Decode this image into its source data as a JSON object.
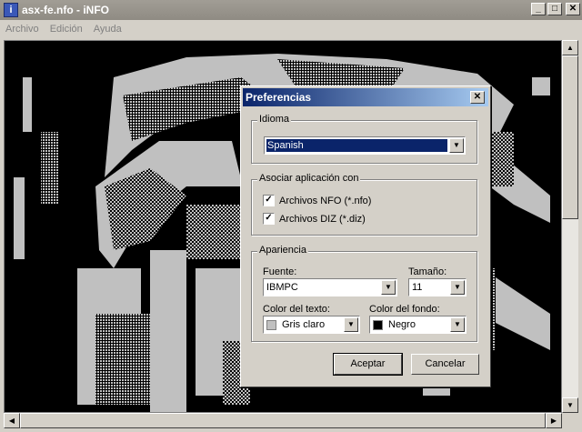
{
  "window": {
    "title": "asx-fe.nfo - iNFO",
    "app_icon": "info-icon"
  },
  "menu": [
    "Archivo",
    "Edición",
    "Ayuda"
  ],
  "dialog": {
    "title": "Preferencias",
    "idioma": {
      "group_label": "Idioma",
      "value": "Spanish"
    },
    "asociar": {
      "group_label": "Asociar aplicación con",
      "options": [
        {
          "label": "Archivos NFO (*.nfo)",
          "checked": true
        },
        {
          "label": "Archivos DIZ (*.diz)",
          "checked": true
        }
      ]
    },
    "apariencia": {
      "group_label": "Apariencia",
      "fuente_label": "Fuente:",
      "fuente_value": "IBMPC",
      "tamano_label": "Tamaño:",
      "tamano_value": "11",
      "color_texto_label": "Color del texto:",
      "color_texto_value": "Gris claro",
      "color_texto_swatch": "#c0c0c0",
      "color_fondo_label": "Color del fondo:",
      "color_fondo_value": "Negro",
      "color_fondo_swatch": "#000000"
    },
    "buttons": {
      "ok": "Aceptar",
      "cancel": "Cancelar"
    }
  },
  "colors": {
    "title_active": "#0a246a",
    "viewer_bg": "#000000",
    "art": "#c0c0c0"
  }
}
